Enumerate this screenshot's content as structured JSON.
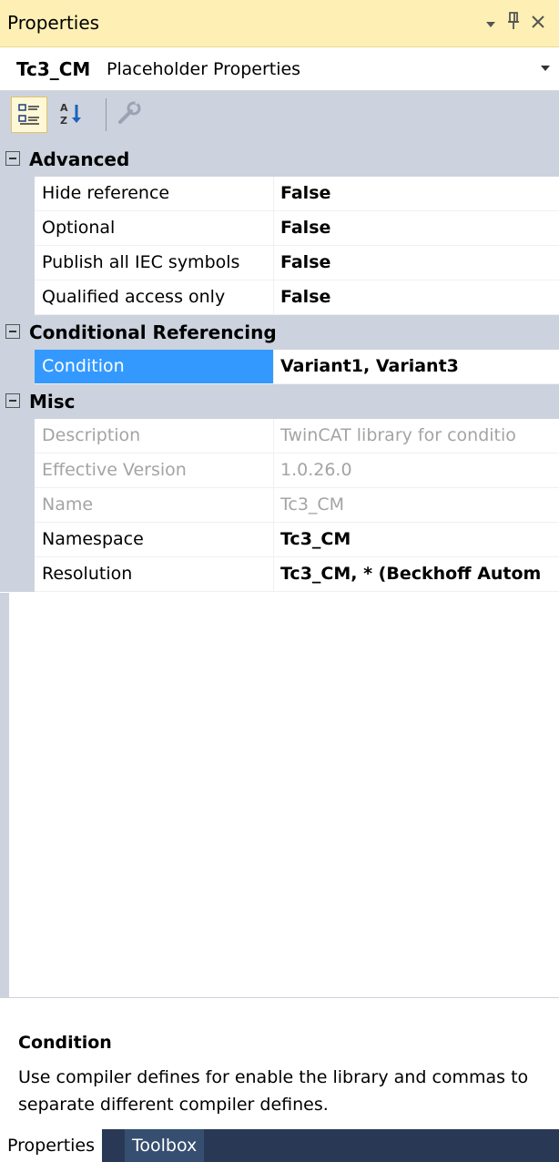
{
  "window": {
    "title": "Properties",
    "controls": {
      "dropdown_icon": "dropdown-arrow-icon",
      "pin_icon": "pin-icon",
      "close_icon": "close-icon"
    }
  },
  "object_selector": {
    "name": "Tc3_CM",
    "type": "Placeholder Properties"
  },
  "toolbar": {
    "buttons": [
      {
        "icon": "categorized-icon",
        "active": true
      },
      {
        "icon": "alphabetical-sort-icon",
        "active": false
      },
      {
        "icon": "property-pages-icon",
        "active": false,
        "disabled": true
      }
    ]
  },
  "grid": {
    "categories": [
      {
        "label": "Advanced",
        "properties": [
          {
            "name": "Hide reference",
            "value": "False"
          },
          {
            "name": "Optional",
            "value": "False"
          },
          {
            "name": "Publish all IEC symbols",
            "value": "False"
          },
          {
            "name": "Qualified access only",
            "value": "False"
          }
        ]
      },
      {
        "label": "Conditional Referencing",
        "properties": [
          {
            "name": "Condition",
            "value": "Variant1, Variant3",
            "selected": true
          }
        ]
      },
      {
        "label": "Misc",
        "properties": [
          {
            "name": "Description",
            "value": "TwinCAT library for conditio",
            "disabled": true
          },
          {
            "name": "Effective Version",
            "value": "1.0.26.0",
            "disabled": true
          },
          {
            "name": "Name",
            "value": "Tc3_CM",
            "disabled": true
          },
          {
            "name": "Namespace",
            "value": "Tc3_CM"
          },
          {
            "name": "Resolution",
            "value": "Tc3_CM, * (Beckhoff Autom"
          }
        ]
      }
    ]
  },
  "description": {
    "title": "Condition",
    "text": "Use compiler defines for enable the library and commas to separate different compiler defines."
  },
  "tabs": [
    {
      "label": "Properties",
      "active": true
    },
    {
      "label": "Toolbox",
      "active": false
    }
  ]
}
